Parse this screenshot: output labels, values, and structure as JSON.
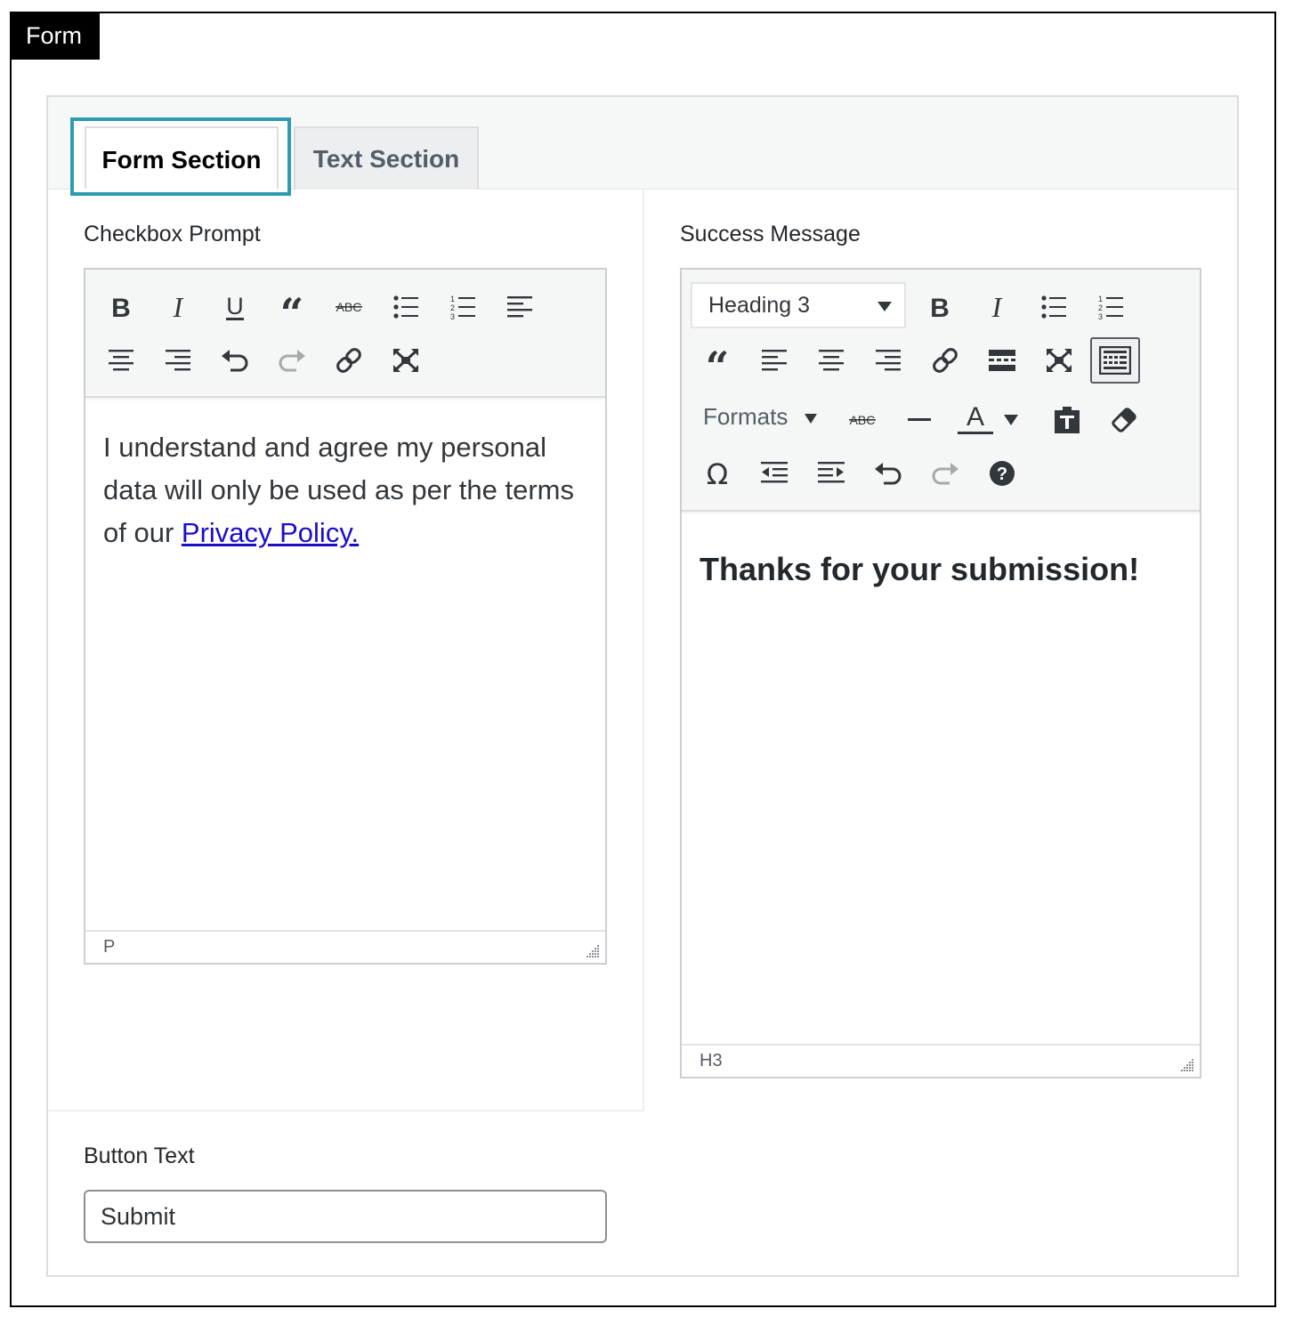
{
  "frame": {
    "title": "Form"
  },
  "tabs": [
    {
      "label": "Form Section",
      "active": true
    },
    {
      "label": "Text Section",
      "active": false
    }
  ],
  "checkbox_prompt": {
    "label": "Checkbox Prompt",
    "toolbar_icons": [
      "bold-icon",
      "italic-icon",
      "underline-icon",
      "blockquote-icon",
      "strikethrough-icon",
      "bullet-list-icon",
      "numbered-list-icon",
      "align-left-icon",
      "align-center-icon",
      "align-right-icon",
      "undo-icon",
      "redo-icon",
      "link-icon",
      "fullscreen-icon"
    ],
    "content_text": "I understand and agree my personal data will only be used as per the terms of our ",
    "content_link": "Privacy Policy.",
    "status_path": "P"
  },
  "success_message": {
    "label": "Success Message",
    "format_value": "Heading 3",
    "formats_label": "Formats",
    "toolbar_icons": [
      "bold-icon",
      "italic-icon",
      "bullet-list-icon",
      "numbered-list-icon",
      "blockquote-icon",
      "align-left-icon",
      "align-center-icon",
      "align-right-icon",
      "link-icon",
      "read-more-icon",
      "fullscreen-icon",
      "toolbar-toggle-icon",
      "strikethrough-icon",
      "horizontal-line-icon",
      "text-color-icon",
      "paste-as-text-icon",
      "clear-formatting-icon",
      "special-character-icon",
      "outdent-icon",
      "indent-icon",
      "undo-icon",
      "redo-icon",
      "help-icon"
    ],
    "content_heading": "Thanks for your submission!",
    "status_path": "H3"
  },
  "button_text": {
    "label": "Button Text",
    "value": "Submit"
  }
}
